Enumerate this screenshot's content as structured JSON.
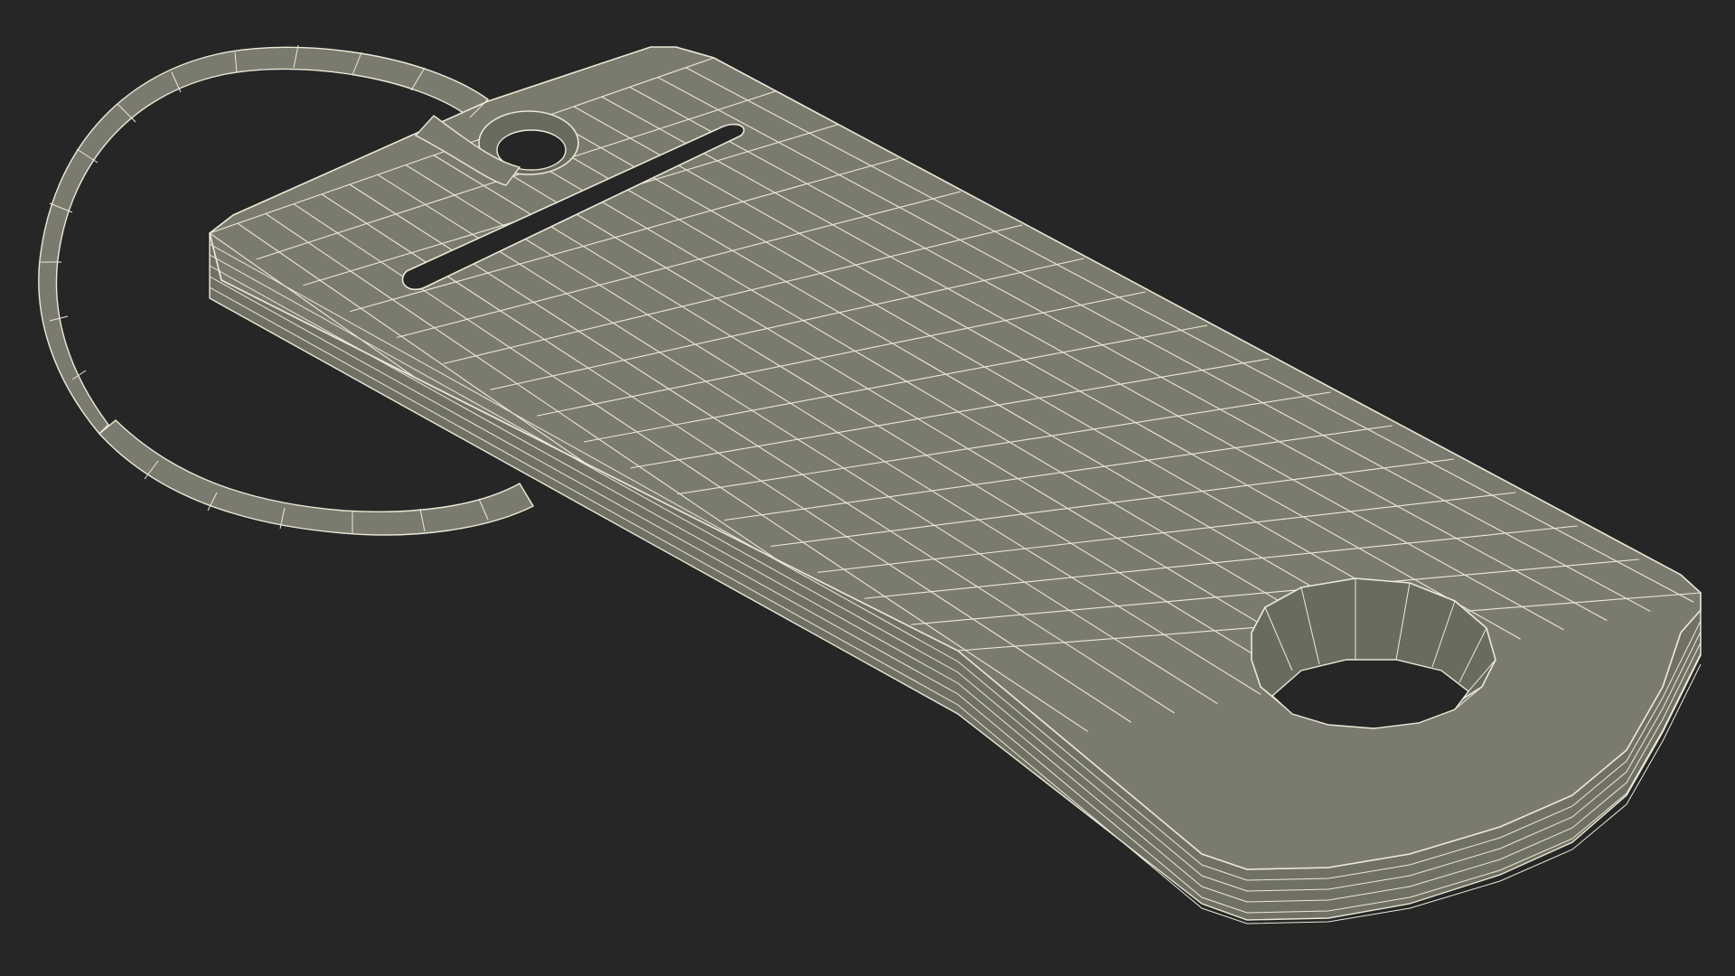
{
  "scene": {
    "background_color": "#262626",
    "object_fill": "#7a7b6e",
    "object_fill_dark": "#6a6b5f",
    "object_fill_side": "#707164",
    "wire_color": "#ece9d8",
    "hole_color": "#262626",
    "icons": [
      "key-tag-object",
      "key-ring-object"
    ]
  }
}
